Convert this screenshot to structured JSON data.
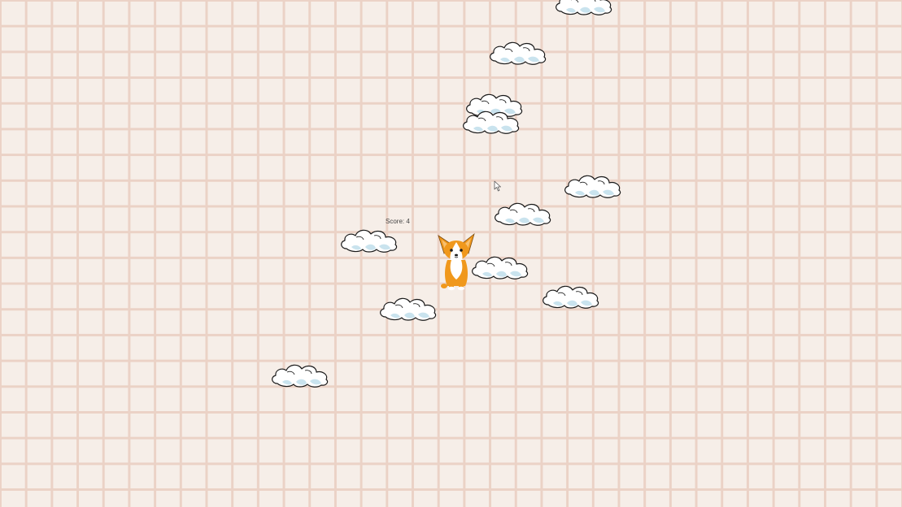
{
  "game": {
    "score_label": "Score:",
    "score": "4",
    "player": "corgi",
    "platform": "cloud",
    "cursor": "arrow-cursor-icon"
  },
  "colors": {
    "background": "#f6eee8",
    "grid_line": "#ebd2c6",
    "cloud_fill": "#ffffff",
    "cloud_shade": "#c9e3ee",
    "cloud_outline": "#1a1a1a",
    "corgi_orange": "#f0981c",
    "corgi_white": "#ffffff",
    "score_text": "#444444"
  }
}
